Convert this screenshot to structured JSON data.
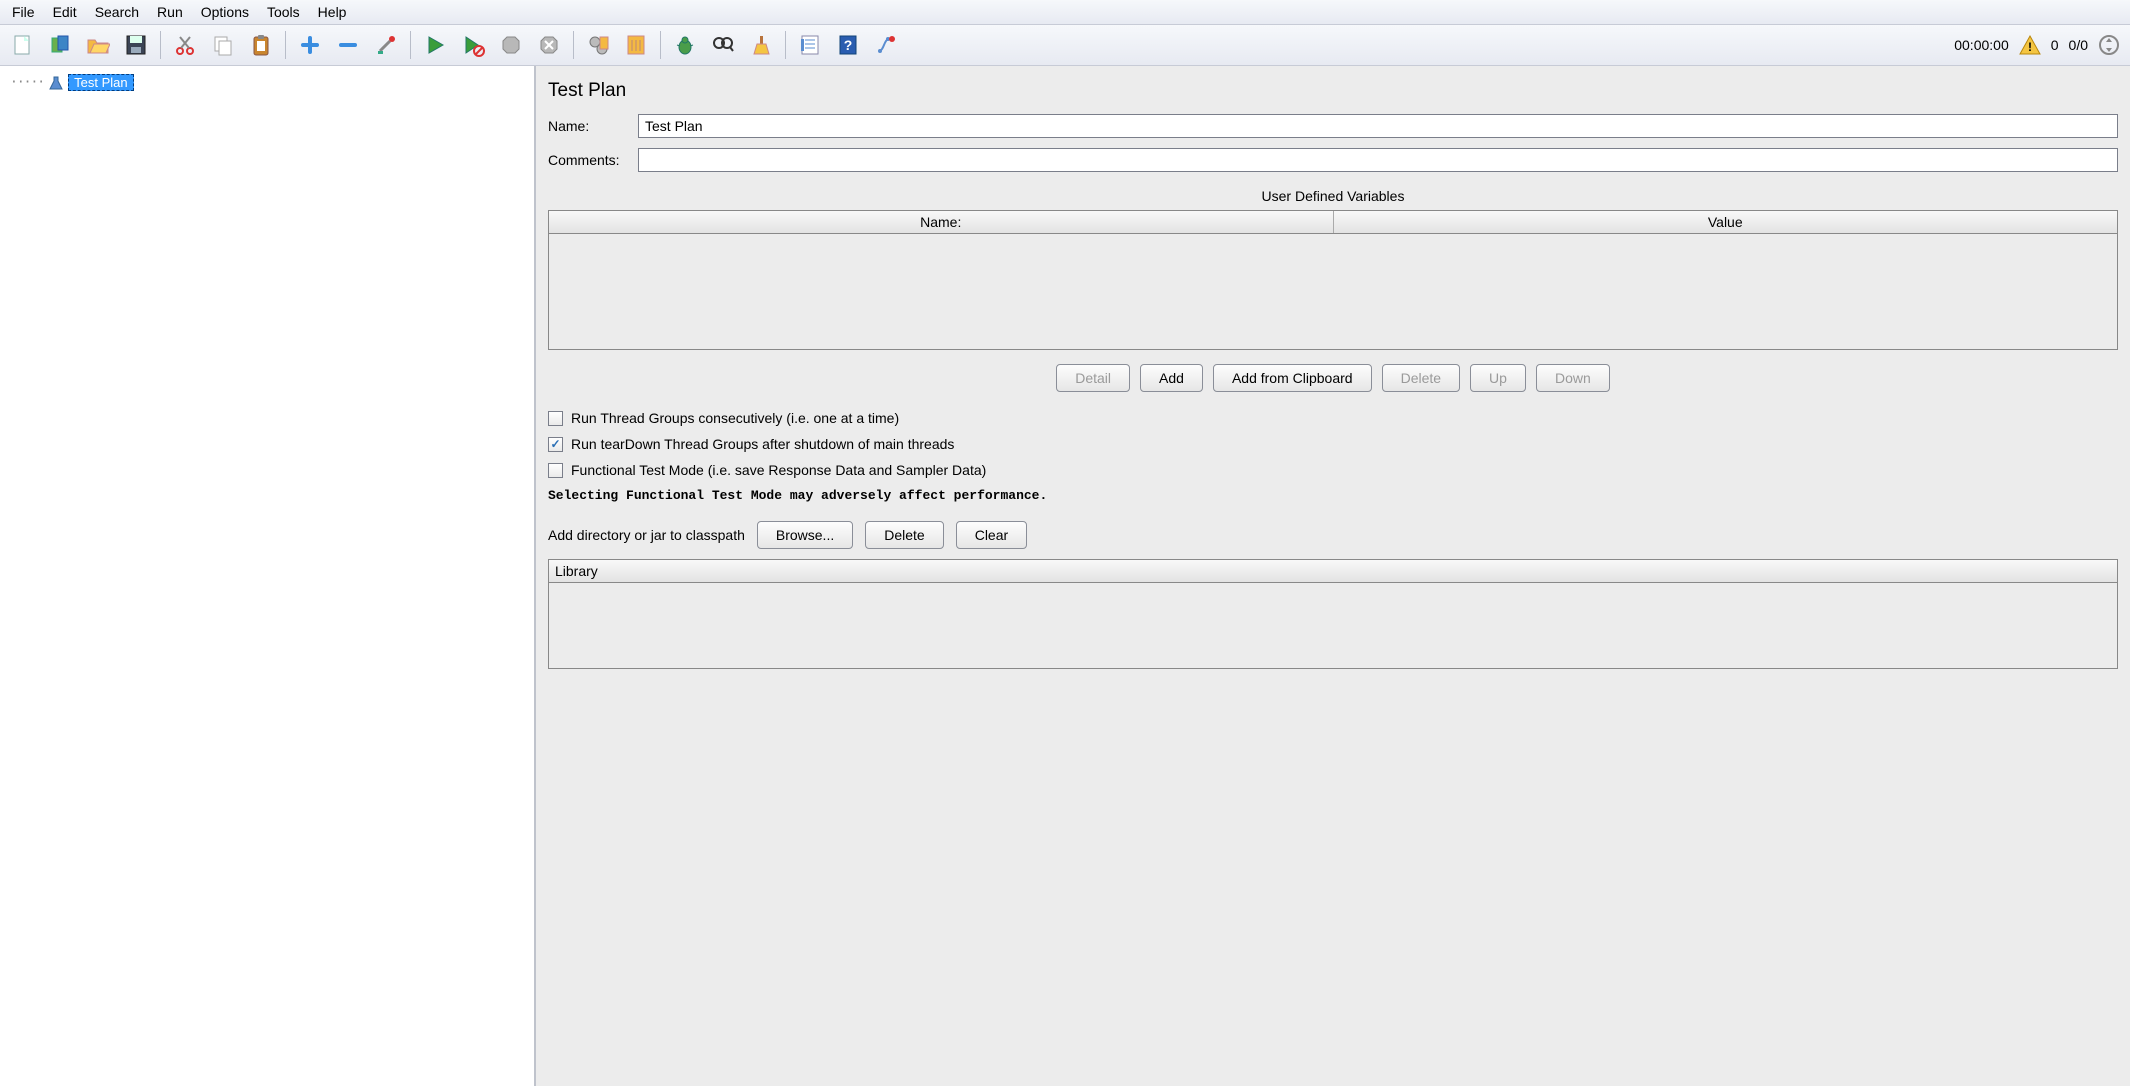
{
  "menu": {
    "file": "File",
    "edit": "Edit",
    "search": "Search",
    "run": "Run",
    "options": "Options",
    "tools": "Tools",
    "help": "Help"
  },
  "toolbar": {
    "icons": {
      "new": "new-file-icon",
      "templates": "templates-icon",
      "open": "open-icon",
      "save": "save-icon",
      "cut": "cut-icon",
      "copy": "copy-icon",
      "paste": "paste-icon",
      "add": "add-icon",
      "remove": "remove-icon",
      "color_picker": "color-picker-icon",
      "start": "start-icon",
      "start_no_pause": "start-no-pauses-icon",
      "stop": "stop-icon",
      "shutdown": "shutdown-icon",
      "clear": "clear-gears-icon",
      "clear_all": "clear-all-icon",
      "debug": "debug-icon",
      "find": "find-icon",
      "broom": "clean-icon",
      "report": "report-icon",
      "help": "help-icon",
      "function": "function-helper-icon"
    },
    "status": {
      "elapsed": "00:00:00",
      "warn_count": "0",
      "threads": "0/0"
    }
  },
  "tree": {
    "root": "Test Plan"
  },
  "panel": {
    "title": "Test Plan",
    "name_label": "Name:",
    "name_value": "Test Plan",
    "comments_label": "Comments:",
    "comments_value": "",
    "vars_section": "User Defined Variables",
    "vars_headers": {
      "name": "Name:",
      "value": "Value"
    },
    "buttons": {
      "detail": "Detail",
      "add": "Add",
      "add_clipboard": "Add from Clipboard",
      "delete": "Delete",
      "up": "Up",
      "down": "Down"
    },
    "checks": {
      "run_consecutive": "Run Thread Groups consecutively (i.e. one at a time)",
      "run_teardown": "Run tearDown Thread Groups after shutdown of main threads",
      "functional_mode": "Functional Test Mode (i.e. save Response Data and Sampler Data)"
    },
    "note": "Selecting Functional Test Mode may adversely affect performance.",
    "classpath_label": "Add directory or jar to classpath",
    "classpath_buttons": {
      "browse": "Browse...",
      "delete": "Delete",
      "clear": "Clear"
    },
    "lib_header": "Library"
  }
}
